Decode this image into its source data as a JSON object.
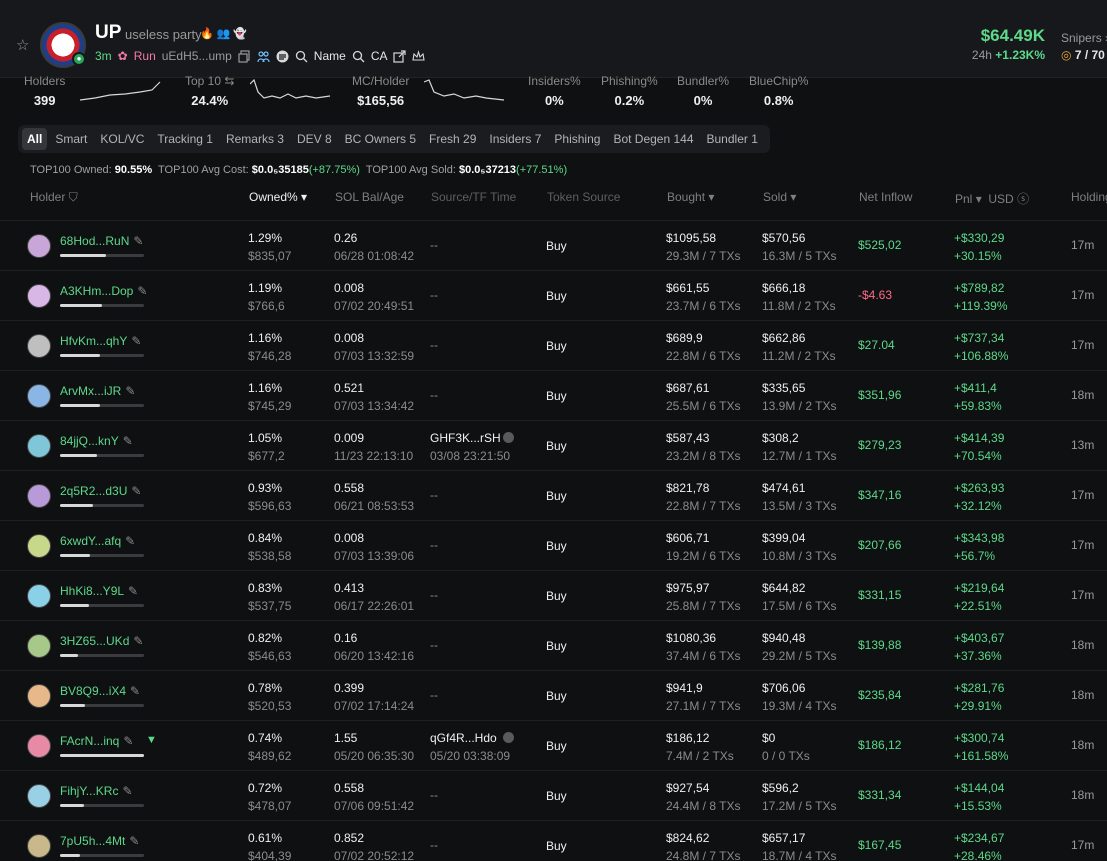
{
  "token": {
    "symbol": "UP",
    "name": "useless party",
    "emojis": "🔥👥👻",
    "age": "3m",
    "run_label": "Run",
    "address": "uEdH5...ump",
    "link_name": "Name",
    "link_ca": "CA",
    "market_cap": "$64.49K",
    "change_label": "24h",
    "change_value": "+1.23K%",
    "snipers_label": "Snipers",
    "snipers_value": "7 / 70"
  },
  "stats": [
    {
      "label": "Holders",
      "value": "399"
    },
    {
      "label": "Top 10",
      "value": "24.4%"
    },
    {
      "label": "MC/Holder",
      "value": "$165,56"
    },
    {
      "label": "Insiders%",
      "value": "0%"
    },
    {
      "label": "Phishing%",
      "value": "0.2%"
    },
    {
      "label": "Bundler%",
      "value": "0%"
    },
    {
      "label": "BlueChip%",
      "value": "0.8%"
    }
  ],
  "tabs": [
    "All",
    "Smart",
    "KOL/VC",
    "Tracking 1",
    "Remarks 3",
    "DEV 8",
    "BC Owners 5",
    "Fresh 29",
    "Insiders 7",
    "Phishing",
    "Bot Degen 144",
    "Bundler 1"
  ],
  "summary": {
    "owned_label": "TOP100 Owned:",
    "owned_value": "90.55%",
    "cost_label": "TOP100 Avg Cost:",
    "cost_value": "$0.0₅35185",
    "cost_change": "(+87.75%)",
    "sold_label": "TOP100 Avg Sold:",
    "sold_value": "$0.0₅37213",
    "sold_change": "(+77.51%)"
  },
  "columns": {
    "holder": "Holder",
    "owned": "Owned%",
    "sol": "SOL Bal/Age",
    "source": "Source/TF Time",
    "token_source": "Token Source",
    "bought": "Bought",
    "sold": "Sold",
    "net": "Net Inflow",
    "pnl": "Pnl",
    "usd": "USD",
    "holding": "Holding"
  },
  "colors": {
    "green": "#5dd98a",
    "red": "#ff6a8a"
  },
  "rows": [
    {
      "addr": "68Hod...RuN",
      "owned": "1.29%",
      "owned_usd": "$835,07",
      "owned_frac": 0.55,
      "sol": "0.26",
      "age": "06/28 01:08:42",
      "src": "--",
      "src_time": "",
      "token_source": "Buy",
      "bought": "$1095,58",
      "bought_sub": "29.3M / 7 TXs",
      "sold": "$570,56",
      "sold_sub": "16.3M / 5 TXs",
      "net": "$525,02",
      "net_neg": false,
      "pnl": "+$330,29",
      "pnl_pct": "+30.15%",
      "holding": "17m",
      "avatar": "#c9a6d8"
    },
    {
      "addr": "A3KHm...Dop",
      "owned": "1.19%",
      "owned_usd": "$766,6",
      "owned_frac": 0.5,
      "sol": "0.008",
      "age": "07/02 20:49:51",
      "src": "--",
      "src_time": "",
      "token_source": "Buy",
      "bought": "$661,55",
      "bought_sub": "23.7M / 6 TXs",
      "sold": "$666,18",
      "sold_sub": "11.8M / 2 TXs",
      "net": "-$4.63",
      "net_neg": true,
      "pnl": "+$789,82",
      "pnl_pct": "+119.39%",
      "holding": "17m",
      "avatar": "#d8b6e6"
    },
    {
      "addr": "HfvKm...qhY",
      "owned": "1.16%",
      "owned_usd": "$746,28",
      "owned_frac": 0.48,
      "sol": "0.008",
      "age": "07/03 13:32:59",
      "src": "--",
      "src_time": "",
      "token_source": "Buy",
      "bought": "$689,9",
      "bought_sub": "22.8M / 6 TXs",
      "sold": "$662,86",
      "sold_sub": "11.2M / 2 TXs",
      "net": "$27.04",
      "net_neg": false,
      "pnl": "+$737,34",
      "pnl_pct": "+106.88%",
      "holding": "17m",
      "avatar": "#bfbfbf"
    },
    {
      "addr": "ArvMx...iJR",
      "owned": "1.16%",
      "owned_usd": "$745,29",
      "owned_frac": 0.48,
      "sol": "0.521",
      "age": "07/03 13:34:42",
      "src": "--",
      "src_time": "",
      "token_source": "Buy",
      "bought": "$687,61",
      "bought_sub": "25.5M / 6 TXs",
      "sold": "$335,65",
      "sold_sub": "13.9M / 2 TXs",
      "net": "$351,96",
      "net_neg": false,
      "pnl": "+$411,4",
      "pnl_pct": "+59.83%",
      "holding": "18m",
      "avatar": "#8ab6e6"
    },
    {
      "addr": "84jjQ...knY",
      "owned": "1.05%",
      "owned_usd": "$677,2",
      "owned_frac": 0.44,
      "sol": "0.009",
      "age": "11/23 22:13:10",
      "src": "GHF3K...rSH",
      "src_time": "03/08 23:21:50",
      "token_source": "Buy",
      "bought": "$587,43",
      "bought_sub": "23.2M / 8 TXs",
      "sold": "$308,2",
      "sold_sub": "12.7M / 1 TXs",
      "net": "$279,23",
      "net_neg": false,
      "pnl": "+$414,39",
      "pnl_pct": "+70.54%",
      "holding": "13m",
      "avatar": "#7fc6d8"
    },
    {
      "addr": "2q5R2...d3U",
      "owned": "0.93%",
      "owned_usd": "$596,63",
      "owned_frac": 0.39,
      "sol": "0.558",
      "age": "06/21 08:53:53",
      "src": "--",
      "src_time": "",
      "token_source": "Buy",
      "bought": "$821,78",
      "bought_sub": "22.8M / 7 TXs",
      "sold": "$474,61",
      "sold_sub": "13.5M / 3 TXs",
      "net": "$347,16",
      "net_neg": false,
      "pnl": "+$263,93",
      "pnl_pct": "+32.12%",
      "holding": "17m",
      "avatar": "#b99ad8"
    },
    {
      "addr": "6xwdY...afq",
      "owned": "0.84%",
      "owned_usd": "$538,58",
      "owned_frac": 0.36,
      "sol": "0.008",
      "age": "07/03 13:39:06",
      "src": "--",
      "src_time": "",
      "token_source": "Buy",
      "bought": "$606,71",
      "bought_sub": "19.2M / 6 TXs",
      "sold": "$399,04",
      "sold_sub": "10.8M / 3 TXs",
      "net": "$207,66",
      "net_neg": false,
      "pnl": "+$343,98",
      "pnl_pct": "+56.7%",
      "holding": "17m",
      "avatar": "#c8d88a"
    },
    {
      "addr": "HhKi8...Y9L",
      "owned": "0.83%",
      "owned_usd": "$537,75",
      "owned_frac": 0.35,
      "sol": "0.413",
      "age": "06/17 22:26:01",
      "src": "--",
      "src_time": "",
      "token_source": "Buy",
      "bought": "$975,97",
      "bought_sub": "25.8M / 7 TXs",
      "sold": "$644,82",
      "sold_sub": "17.5M / 6 TXs",
      "net": "$331,15",
      "net_neg": false,
      "pnl": "+$219,64",
      "pnl_pct": "+22.51%",
      "holding": "17m",
      "avatar": "#8ad0e6"
    },
    {
      "addr": "3HZ65...UKd",
      "owned": "0.82%",
      "owned_usd": "$546,63",
      "owned_frac": 0.22,
      "sol": "0.16",
      "age": "06/20 13:42:16",
      "src": "--",
      "src_time": "",
      "token_source": "Buy",
      "bought": "$1080,36",
      "bought_sub": "37.4M / 6 TXs",
      "sold": "$940,48",
      "sold_sub": "29.2M / 5 TXs",
      "net": "$139,88",
      "net_neg": false,
      "pnl": "+$403,67",
      "pnl_pct": "+37.36%",
      "holding": "18m",
      "avatar": "#a6c98a"
    },
    {
      "addr": "BV8Q9...iX4",
      "owned": "0.78%",
      "owned_usd": "$520,53",
      "owned_frac": 0.3,
      "sol": "0.399",
      "age": "07/02 17:14:24",
      "src": "--",
      "src_time": "",
      "token_source": "Buy",
      "bought": "$941,9",
      "bought_sub": "27.1M / 7 TXs",
      "sold": "$706,06",
      "sold_sub": "19.3M / 4 TXs",
      "net": "$235,84",
      "net_neg": false,
      "pnl": "+$281,76",
      "pnl_pct": "+29.91%",
      "holding": "18m",
      "avatar": "#e6b88a"
    },
    {
      "addr": "FAcrN...inq",
      "owned": "0.74%",
      "owned_usd": "$489,62",
      "owned_frac": 1.0,
      "sol": "1.55",
      "age": "05/20 06:35:30",
      "src": "qGf4R...Hdo",
      "src_time": "05/20 03:38:09",
      "token_source": "Buy",
      "bought": "$186,12",
      "bought_sub": "7.4M / 2 TXs",
      "sold": "$0",
      "sold_sub": "0 / 0 TXs",
      "net": "$186,12",
      "net_neg": false,
      "pnl": "+$300,74",
      "pnl_pct": "+161.58%",
      "holding": "18m",
      "avatar": "#e68aa6"
    },
    {
      "addr": "FihjY...KRc",
      "owned": "0.72%",
      "owned_usd": "$478,07",
      "owned_frac": 0.28,
      "sol": "0.558",
      "age": "07/06 09:51:42",
      "src": "--",
      "src_time": "",
      "token_source": "Buy",
      "bought": "$927,54",
      "bought_sub": "24.4M / 8 TXs",
      "sold": "$596,2",
      "sold_sub": "17.2M / 5 TXs",
      "net": "$331,34",
      "net_neg": false,
      "pnl": "+$144,04",
      "pnl_pct": "+15.53%",
      "holding": "18m",
      "avatar": "#9ad0e6"
    },
    {
      "addr": "7pU5h...4Mt",
      "owned": "0.61%",
      "owned_usd": "$404,39",
      "owned_frac": 0.24,
      "sol": "0.852",
      "age": "07/02 20:52:12",
      "src": "--",
      "src_time": "",
      "token_source": "Buy",
      "bought": "$824,62",
      "bought_sub": "24.8M / 7 TXs",
      "sold": "$657,17",
      "sold_sub": "18.7M / 4 TXs",
      "net": "$167,45",
      "net_neg": false,
      "pnl": "+$234,67",
      "pnl_pct": "+28.46%",
      "holding": "17m",
      "avatar": "#c9b88a"
    }
  ]
}
